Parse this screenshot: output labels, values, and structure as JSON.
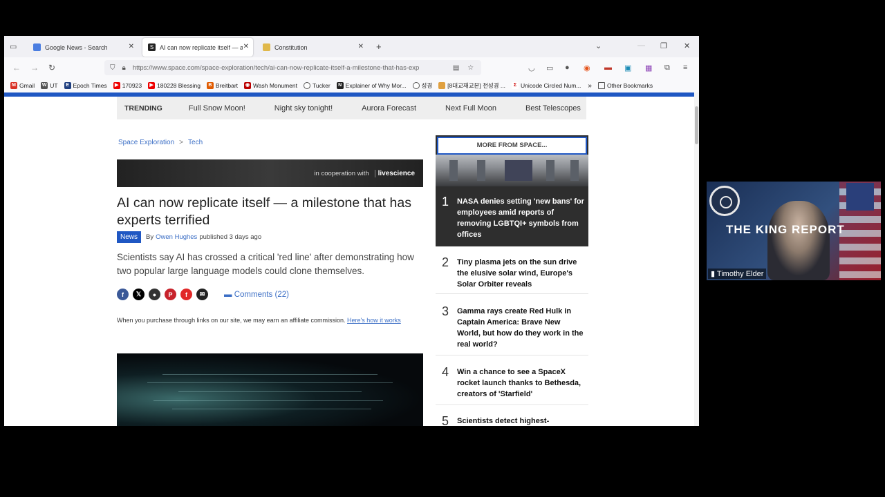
{
  "tabs": [
    {
      "title": "Google News - Search"
    },
    {
      "title": "AI can now replicate itself — a m"
    },
    {
      "title": "Constitution"
    }
  ],
  "url": {
    "domain": "https://www.space.com",
    "path": "/space-exploration/tech/ai-can-now-replicate-itself-a-milestone-that-has-exp"
  },
  "bookmarks": [
    "Gmail",
    "UT",
    "Epoch Times",
    "170923",
    "180228 Blessing",
    "Breitbart",
    "Wash Monument",
    "Tucker",
    "Explainer of Why Mor...",
    "성경",
    "[8대교재교본] 천성경 ...",
    "Unicode Circled Num...",
    "Other Bookmarks"
  ],
  "trending": {
    "title": "TRENDING",
    "items": [
      "Full Snow Moon!",
      "Night sky tonight!",
      "Aurora Forecast",
      "Next Full Moon",
      "Best Telescopes"
    ]
  },
  "breadcrumb": {
    "section": "Space Exploration",
    "sep": ">",
    "sub": "Tech"
  },
  "coop": {
    "text": "in cooperation with",
    "logo": "livescience"
  },
  "article": {
    "headline": "AI can now replicate itself — a milestone that has experts terrified",
    "badge": "News",
    "by": "By",
    "author": "Owen Hughes",
    "published": "published 3 days ago",
    "standfirst": "Scientists say AI has crossed a critical 'red line' after demonstrating how two popular large language models could clone themselves.",
    "comments": "Comments (22)",
    "affiliate": "When you purchase through links on our site, we may earn an affiliate commission.",
    "affiliate_link": "Here's how it works"
  },
  "sidebar": {
    "header": "MORE FROM SPACE...",
    "items": [
      {
        "num": "1",
        "title": "NASA denies setting 'new bans' for employees amid reports of removing LGBTQI+ symbols from offices"
      },
      {
        "num": "2",
        "title": "Tiny plasma jets on the sun drive the elusive solar wind, Europe's Solar Orbiter reveals"
      },
      {
        "num": "3",
        "title": "Gamma rays create Red Hulk in Captain America: Brave New World, but how do they work in the real world?"
      },
      {
        "num": "4",
        "title": "Win a chance to see a SpaceX rocket launch thanks to Bethesda, creators of 'Starfield'"
      },
      {
        "num": "5",
        "title": "Scientists detect highest-"
      }
    ]
  },
  "video": {
    "show": "THE KING REPORT",
    "participant": "Timothy Elder"
  }
}
